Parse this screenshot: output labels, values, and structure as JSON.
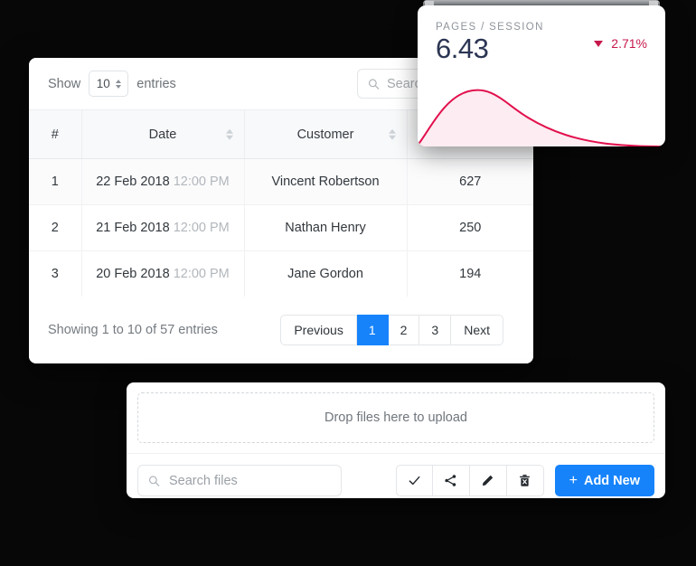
{
  "kpi_card": {
    "label": "PAGES / SESSION",
    "value": "6.43",
    "delta": "2.71%",
    "delta_direction": "down",
    "delta_color": "#c7184b",
    "value_color": "#2b3553",
    "spark_line_color": "#e2104d",
    "spark_fill_color": "#fdecf1"
  },
  "table_card": {
    "toolbar": {
      "show_label": "Show",
      "entries_value": "10",
      "entries_label": "entries",
      "search_placeholder": "Search...",
      "search_value": "",
      "search_icon": "search-icon"
    },
    "columns": [
      {
        "label": "#",
        "sortable": false
      },
      {
        "label": "Date",
        "sortable": true
      },
      {
        "label": "Customer",
        "sortable": true
      },
      {
        "label": "",
        "sortable": false
      }
    ],
    "rows": [
      {
        "idx": "1",
        "date": "22 Feb 2018",
        "time": "12:00 PM",
        "customer": "Vincent Robertson",
        "amount": "627"
      },
      {
        "idx": "2",
        "date": "21 Feb 2018",
        "time": "12:00 PM",
        "customer": "Nathan Henry",
        "amount": "250"
      },
      {
        "idx": "3",
        "date": "20 Feb 2018",
        "time": "12:00 PM",
        "customer": "Jane Gordon",
        "amount": "194"
      }
    ],
    "footer": {
      "showing_text": "Showing 1 to 10 of 57 entries",
      "pagination": {
        "previous_label": "Previous",
        "pages": [
          "1",
          "2",
          "3"
        ],
        "active_page": "1",
        "next_label": "Next",
        "active_color": "#1683fb"
      }
    }
  },
  "file_card": {
    "dropzone_text": "Drop files here to upload",
    "search_placeholder": "Search files",
    "search_value": "",
    "search_icon": "search-icon",
    "action_icons": [
      "check-icon",
      "share-icon",
      "pencil-icon",
      "trash-icon"
    ],
    "add_new_label": "Add New",
    "add_new_plus": "+",
    "add_new_color": "#1683fb"
  }
}
